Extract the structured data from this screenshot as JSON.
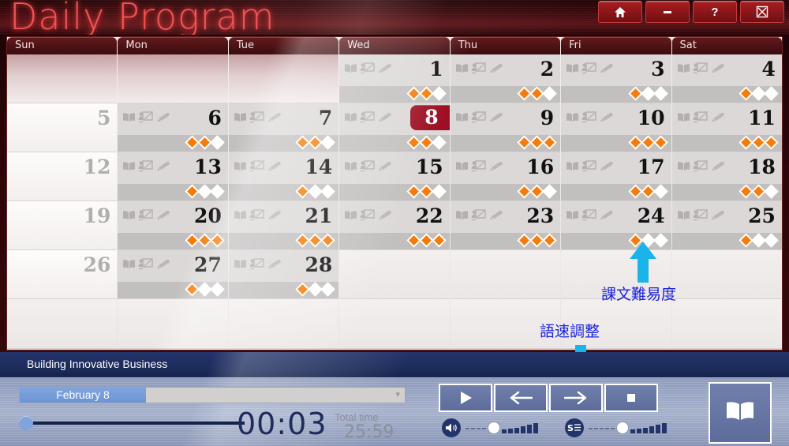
{
  "window": {
    "title": "Daily Program",
    "buttons": [
      {
        "name": "home-button",
        "icon": "home-icon",
        "label": ""
      },
      {
        "name": "minimize-button",
        "icon": "minimize-icon",
        "label": ""
      },
      {
        "name": "help-button",
        "icon": "question-icon",
        "label": "?"
      },
      {
        "name": "close-button",
        "icon": "close-box-icon",
        "label": ""
      }
    ]
  },
  "calendar": {
    "day_headers": [
      "Sun",
      "Mon",
      "Tue",
      "Wed",
      "Thu",
      "Fri",
      "Sat"
    ],
    "selected_day": 8,
    "cell_icons": [
      "book-icon",
      "presentation-icon",
      "pencil-icon"
    ],
    "rating_max": 3,
    "weeks": [
      [
        {
          "day": "",
          "type": "pad"
        },
        {
          "day": "",
          "type": "pad"
        },
        {
          "day": "",
          "type": "pad"
        },
        {
          "day": "1",
          "type": "active",
          "rating": 2
        },
        {
          "day": "2",
          "type": "active",
          "rating": 2
        },
        {
          "day": "3",
          "type": "active",
          "rating": 1
        },
        {
          "day": "4",
          "type": "active",
          "rating": 1
        }
      ],
      [
        {
          "day": "5",
          "type": "sunday"
        },
        {
          "day": "6",
          "type": "active",
          "rating": 2
        },
        {
          "day": "7",
          "type": "active",
          "rating": 2
        },
        {
          "day": "8",
          "type": "selected",
          "rating": 2
        },
        {
          "day": "9",
          "type": "active",
          "rating": 3
        },
        {
          "day": "10",
          "type": "active",
          "rating": 3
        },
        {
          "day": "11",
          "type": "active",
          "rating": 3
        }
      ],
      [
        {
          "day": "12",
          "type": "sunday"
        },
        {
          "day": "13",
          "type": "active",
          "rating": 1
        },
        {
          "day": "14",
          "type": "active",
          "rating": 1
        },
        {
          "day": "15",
          "type": "active",
          "rating": 2
        },
        {
          "day": "16",
          "type": "active",
          "rating": 2
        },
        {
          "day": "17",
          "type": "active",
          "rating": 2
        },
        {
          "day": "18",
          "type": "active",
          "rating": 2
        }
      ],
      [
        {
          "day": "19",
          "type": "sunday"
        },
        {
          "day": "20",
          "type": "active",
          "rating": 3
        },
        {
          "day": "21",
          "type": "active",
          "rating": 3
        },
        {
          "day": "22",
          "type": "active",
          "rating": 3
        },
        {
          "day": "23",
          "type": "active",
          "rating": 3
        },
        {
          "day": "24",
          "type": "active",
          "rating": 1
        },
        {
          "day": "25",
          "type": "active",
          "rating": 1
        }
      ],
      [
        {
          "day": "26",
          "type": "sunday"
        },
        {
          "day": "27",
          "type": "active",
          "rating": 1
        },
        {
          "day": "28",
          "type": "active",
          "rating": 1
        },
        {
          "day": "",
          "type": "blank"
        },
        {
          "day": "",
          "type": "blank"
        },
        {
          "day": "",
          "type": "blank"
        },
        {
          "day": "",
          "type": "blank"
        }
      ],
      [
        {
          "day": "",
          "type": "blank"
        },
        {
          "day": "",
          "type": "blank"
        },
        {
          "day": "",
          "type": "blank"
        },
        {
          "day": "",
          "type": "blank"
        },
        {
          "day": "",
          "type": "blank"
        },
        {
          "day": "",
          "type": "blank"
        },
        {
          "day": "",
          "type": "blank"
        }
      ]
    ]
  },
  "player": {
    "lesson_title": "Building Innovative Business",
    "date_select": {
      "value": "February 8",
      "placeholder": ""
    },
    "current_time": "00:03",
    "total_time_label": "Total time",
    "total_time": "25:59",
    "progress_percent": 3,
    "controls": [
      {
        "name": "play-button",
        "icon": "play-icon"
      },
      {
        "name": "previous-button",
        "icon": "arrow-left-icon"
      },
      {
        "name": "next-button",
        "icon": "arrow-right-icon"
      },
      {
        "name": "stop-button",
        "icon": "stop-icon"
      }
    ],
    "volume_slider": {
      "icon": "speaker-icon",
      "level": 5,
      "dashes": 4,
      "bars": 6
    },
    "speed_slider": {
      "icon": "speed-text-icon",
      "level": 5,
      "dashes": 5,
      "bars": 6
    },
    "book_button": {
      "name": "textbook-button",
      "icon": "book-open-icon"
    }
  },
  "annotations": [
    {
      "text": "課文難易度",
      "arrow": "up",
      "target": "rating-diamonds"
    },
    {
      "text": "語速調整",
      "arrow": "down",
      "target": "speed-slider"
    }
  ],
  "colors": {
    "accent_red": "#9d0f22",
    "title_glow": "#ff5a5a",
    "diamond_on": "#f77b0a",
    "player_navy": "#23346b",
    "annotation_blue": "#1a23e0",
    "arrow_cyan": "#19b5ea"
  }
}
